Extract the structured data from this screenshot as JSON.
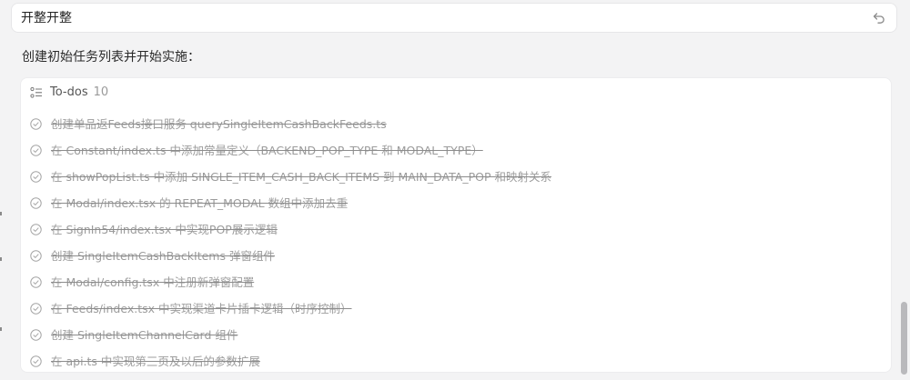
{
  "input": {
    "value": "开整开整"
  },
  "heading": "创建初始任务列表并开始实施：",
  "todos": {
    "title": "To-dos",
    "count": "10",
    "items": [
      {
        "label": "创建单品返Feeds接口服务 querySingleItemCashBackFeeds.ts",
        "done": true
      },
      {
        "label": "在 Constant/index.ts 中添加常量定义（BACKEND_POP_TYPE 和 MODAL_TYPE）",
        "done": true
      },
      {
        "label": "在 showPopList.ts 中添加 SINGLE_ITEM_CASH_BACK_ITEMS 到 MAIN_DATA_POP 和映射关系",
        "done": true
      },
      {
        "label": "在 Modal/index.tsx 的 REPEAT_MODAL 数组中添加去重",
        "done": true
      },
      {
        "label": "在 SignIn54/index.tsx 中实现POP展示逻辑",
        "done": true
      },
      {
        "label": "创建 SingleItemCashBackItems 弹窗组件",
        "done": true
      },
      {
        "label": "在 Modal/config.tsx 中注册新弹窗配置",
        "done": true
      },
      {
        "label": "在 Feeds/index.tsx 中实现渠道卡片插卡逻辑（时序控制）",
        "done": true
      },
      {
        "label": "创建 SingleItemChannelCard 组件",
        "done": true
      },
      {
        "label": "在 api.ts 中实现第三页及以后的参数扩展",
        "done": true
      }
    ]
  },
  "icons": {
    "undo": "undo-arrow-icon",
    "list": "checklist-icon",
    "check": "check-circle-icon"
  },
  "colors": {
    "background": "#f3f3f4",
    "card": "#ffffff",
    "done_text": "#9c9c9c",
    "scroll_thumb": "#b9b9bc"
  }
}
